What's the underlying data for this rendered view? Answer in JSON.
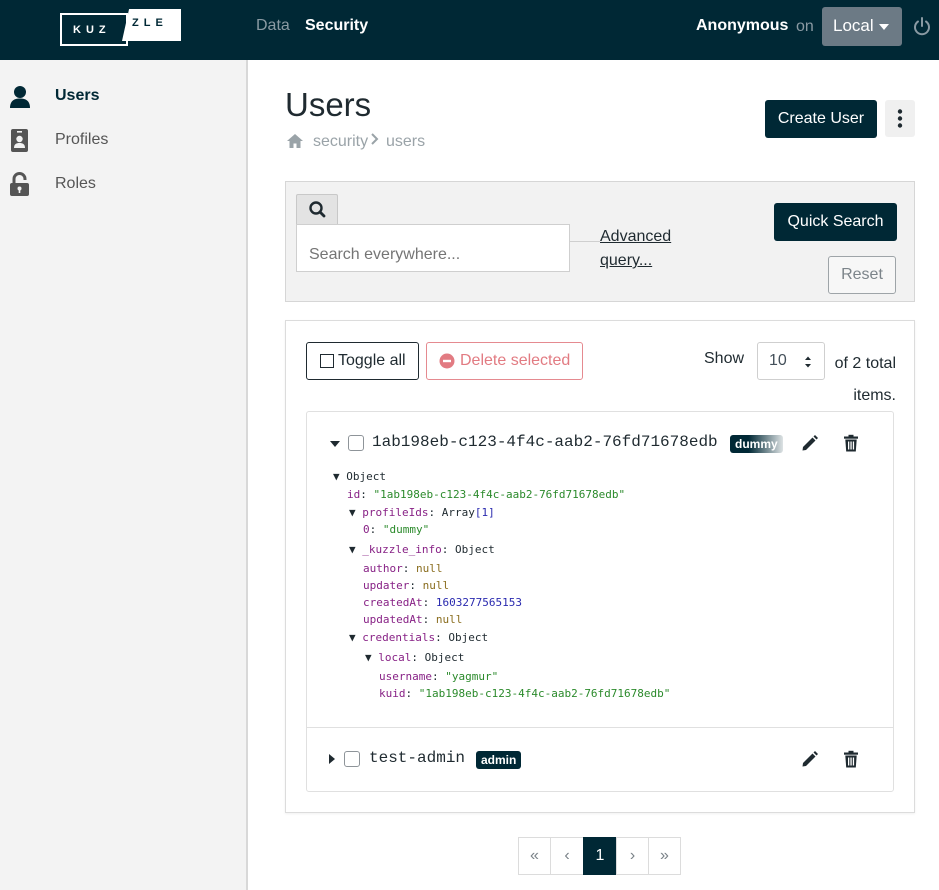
{
  "app": {
    "logo_part1": "KUZ",
    "logo_part2": "ZLE"
  },
  "navbar": {
    "tabs": [
      {
        "label": "Data",
        "active": false
      },
      {
        "label": "Security",
        "active": true
      }
    ],
    "user": "Anonymous",
    "on_label": "on",
    "environment": "Local",
    "icons": {
      "power": "power-icon"
    }
  },
  "sidebar": {
    "items": [
      {
        "label": "Users",
        "icon": "user-icon",
        "active": true
      },
      {
        "label": "Profiles",
        "icon": "id-badge-icon",
        "active": false
      },
      {
        "label": "Roles",
        "icon": "unlock-icon",
        "active": false
      }
    ]
  },
  "header": {
    "title": "Users",
    "breadcrumb": [
      "security",
      "users"
    ],
    "create_label": "Create User"
  },
  "search": {
    "placeholder": "Search everywhere...",
    "advanced_label": "Advanced query...",
    "quick_label": "Quick Search",
    "reset_label": "Reset"
  },
  "list": {
    "toggle_label": "Toggle all",
    "delete_label": "Delete selected",
    "show_label": "Show",
    "page_size": "10",
    "total_label": "of 2 total items.",
    "items": [
      {
        "id": "1ab198eb-c123-4f4c-aab2-76fd71678edb",
        "profile": "dummy",
        "expanded": true,
        "tree": {
          "root": "Object",
          "id_key": "id",
          "id_value": "\"1ab198eb-c123-4f4c-aab2-76fd71678edb\"",
          "profileIds_key": "profileIds",
          "profileIds_type": "Array",
          "profileIds_count": "[1]",
          "profile0_key": "0",
          "profile0_value": "\"dummy\"",
          "kuzzle_info_key": "_kuzzle_info",
          "kuzzle_info_type": "Object",
          "author_key": "author",
          "author_value": "null",
          "updater_key": "updater",
          "updater_value": "null",
          "createdAt_key": "createdAt",
          "createdAt_value": "1603277565153",
          "updatedAt_key": "updatedAt",
          "updatedAt_value": "null",
          "credentials_key": "credentials",
          "credentials_type": "Object",
          "local_key": "local",
          "local_type": "Object",
          "username_key": "username",
          "username_value": "\"yagmur\"",
          "kuid_key": "kuid",
          "kuid_value": "\"1ab198eb-c123-4f4c-aab2-76fd71678edb\""
        }
      },
      {
        "id": "test-admin",
        "profile": "admin",
        "expanded": false
      }
    ]
  },
  "pagination": {
    "first": "«",
    "prev": "‹",
    "current": "1",
    "next": "›",
    "last": "»"
  },
  "colors": {
    "primary": "#002835",
    "sidebar_bg": "#f3f3f3",
    "danger": "#e27b82"
  }
}
